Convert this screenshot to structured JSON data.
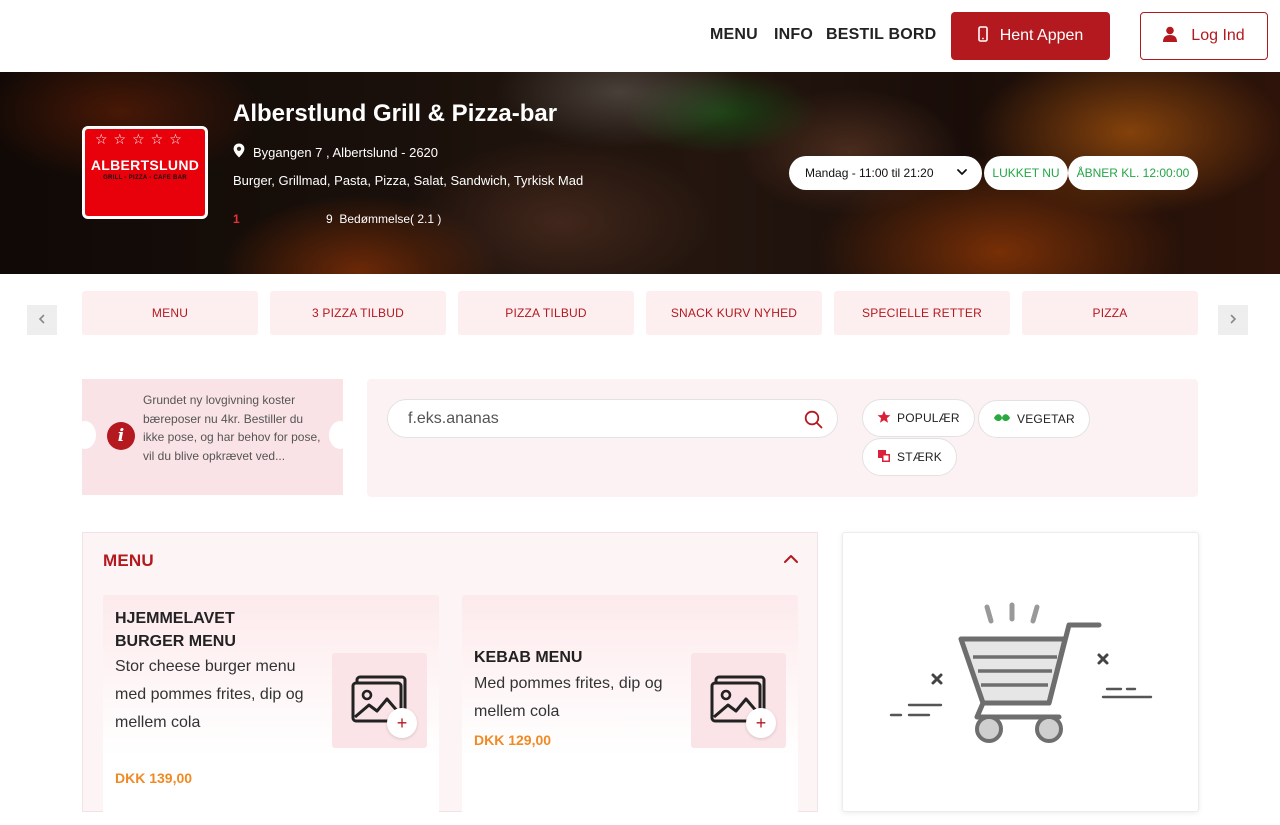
{
  "nav": {
    "links": [
      "MENU",
      "INFO",
      "BESTIL BORD"
    ],
    "app_button": "Hent Appen",
    "login_button": "Log Ind"
  },
  "hero": {
    "title": "Alberstlund Grill & Pizza-bar",
    "address": "Bygangen 7 , Albertslund - 2620",
    "categories": "Burger, Grillmad, Pasta, Pizza, Salat, Sandwich, Tyrkisk Mad",
    "rating_value": "1",
    "review_count": "9",
    "reviews_label": "Bedømmelse( 2.1 )",
    "logo": {
      "name": "ALBERTSLUND",
      "sub": "GRILL - PIZZA - CAFE BAR",
      "stars": "☆☆☆☆☆"
    },
    "hours_selected": "Mandag - 11:00 til 21:20",
    "status_closed": "LUKKET NU",
    "status_opens": "ÅBNER KL. 12:00:00"
  },
  "category_tabs": [
    "MENU",
    "3 PIZZA TILBUD",
    "PIZZA TILBUD",
    "SNACK KURV NYHED",
    "SPECIELLE RETTER",
    "PIZZA"
  ],
  "notice": {
    "text": "Grundet ny lovgivning koster bæreposer nu 4kr. Bestiller du ikke pose, og har behov for pose, vil du blive opkrævet ved..."
  },
  "search": {
    "placeholder": "f.eks.ananas"
  },
  "filters": {
    "popular": "POPULÆR",
    "vegetarian": "VEGETAR",
    "spicy": "STÆRK"
  },
  "menu": {
    "heading": "MENU",
    "items": [
      {
        "title": "HJEMMELAVET BURGER MENU",
        "description": "Stor cheese burger menu med pommes frites, dip og mellem cola",
        "price": "DKK 139,00"
      },
      {
        "title": "KEBAB MENU",
        "description": "Med pommes frites, dip og mellem cola",
        "price": "DKK 129,00"
      }
    ],
    "add_label": "+"
  },
  "colors": {
    "brand": "#b3191f",
    "price": "#f08a24",
    "open_status": "#22a645"
  }
}
